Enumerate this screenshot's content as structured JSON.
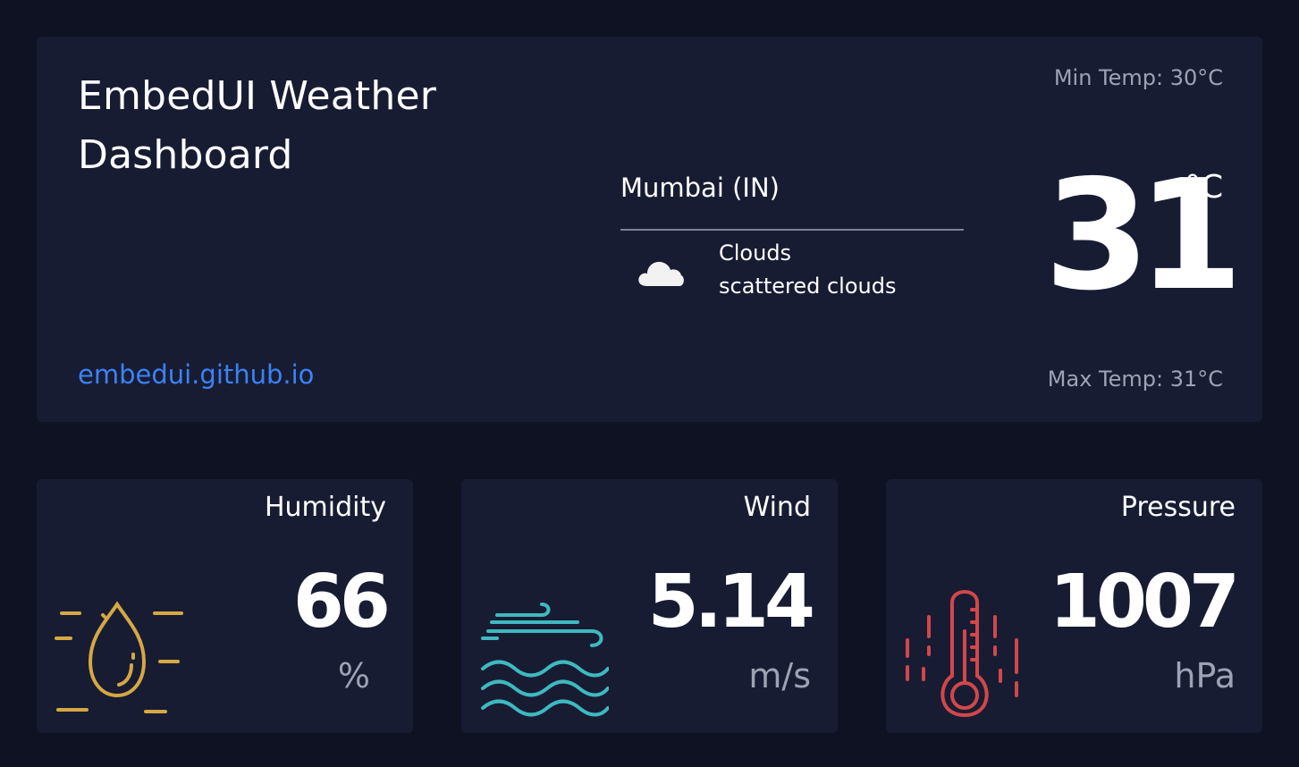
{
  "app": {
    "title": "EmbedUI Weather Dashboard",
    "link_text": "embedui.github.io"
  },
  "location": {
    "city": "Mumbai (IN)"
  },
  "condition": {
    "icon": "cloud-icon",
    "main": "Clouds",
    "description": "scattered clouds"
  },
  "temperature": {
    "current": "31",
    "unit": "°C",
    "min_label": "Min Temp: 30°C",
    "max_label": "Max Temp: 31°C"
  },
  "stats": {
    "humidity": {
      "label": "Humidity",
      "value": "66",
      "unit": "%",
      "icon": "humidity-drop-icon",
      "color": "#d6a843"
    },
    "wind": {
      "label": "Wind",
      "value": "5.14",
      "unit": "m/s",
      "icon": "wind-icon",
      "color": "#3fb9c0"
    },
    "pressure": {
      "label": "Pressure",
      "value": "1007",
      "unit": "hPa",
      "icon": "thermometer-icon",
      "color": "#d2474b"
    }
  },
  "colors": {
    "background": "#0e1222",
    "card": "#181c33",
    "link": "#3b82f6",
    "muted_text": "#9ea2b4"
  }
}
